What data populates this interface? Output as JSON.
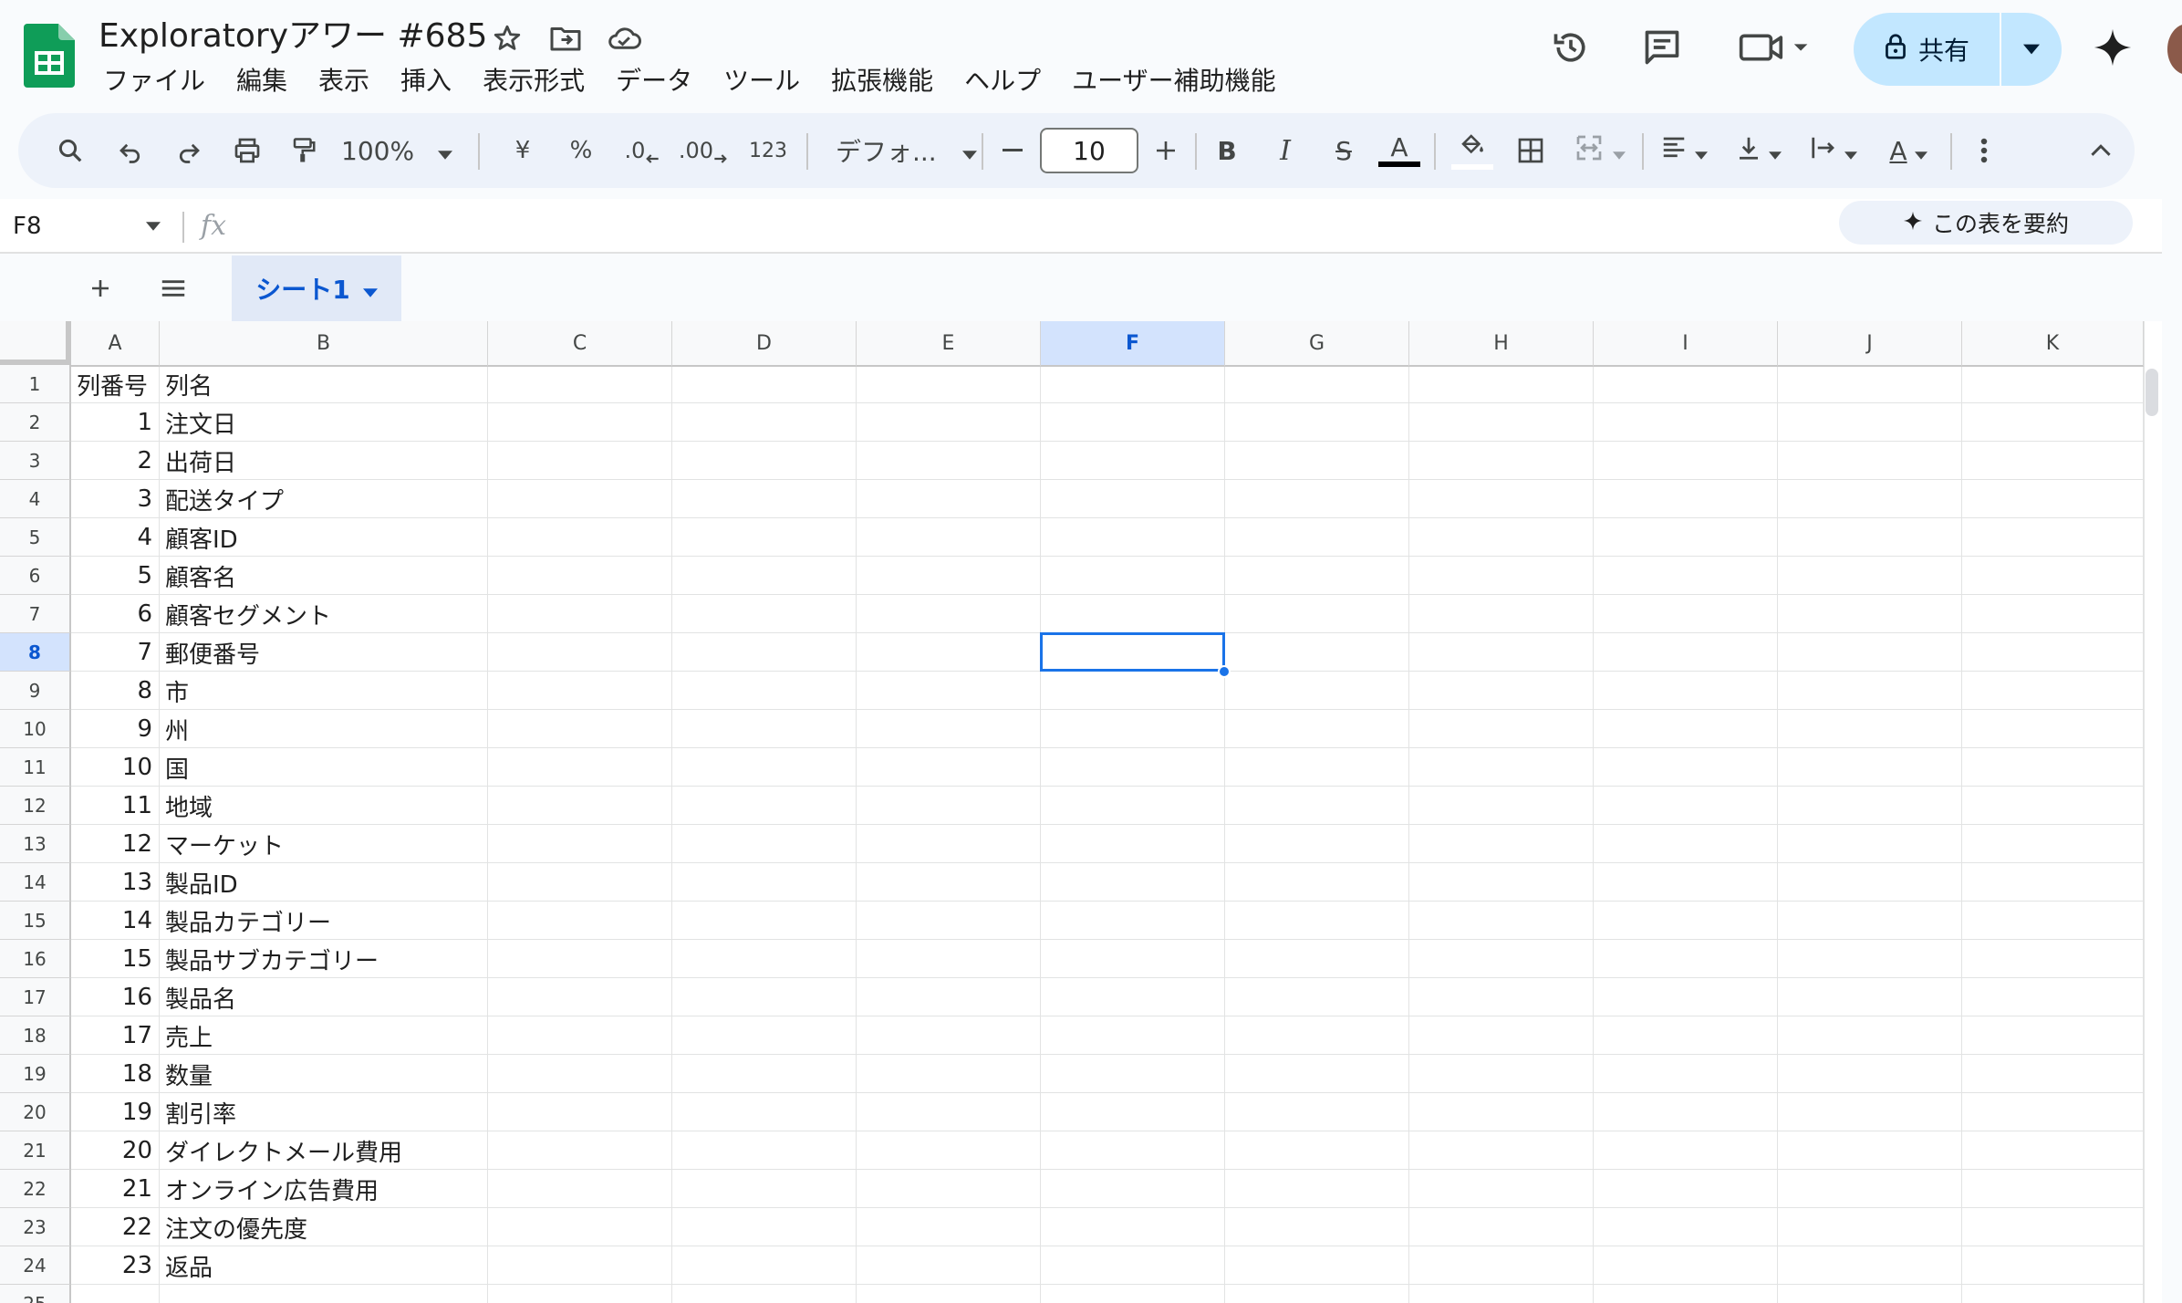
{
  "app": {
    "title": "Exploratoryアワー #685",
    "share_label": "共有"
  },
  "menu": [
    "ファイル",
    "編集",
    "表示",
    "挿入",
    "表示形式",
    "データ",
    "ツール",
    "拡張機能",
    "ヘルプ",
    "ユーザー補助機能"
  ],
  "toolbar": {
    "zoom": "100%",
    "currency": "¥",
    "percent": "%",
    "dec_decrease": ".0",
    "dec_increase": ".00",
    "number_format": "123",
    "font": "デフォ...",
    "font_size": "10",
    "bold": "B",
    "italic": "I",
    "strike": "S",
    "text_color": "A",
    "text_rotate": "A"
  },
  "formula": {
    "name_box": "F8",
    "fx": "fx",
    "summarize_label": "この表を要約"
  },
  "sheet": {
    "tab_label": "シート1"
  },
  "grid": {
    "columns": [
      "A",
      "B",
      "C",
      "D",
      "E",
      "F",
      "G",
      "H",
      "I",
      "J",
      "K"
    ],
    "selected_column": "F",
    "selected_row": "8",
    "row_numbers": [
      "1",
      "2",
      "3",
      "4",
      "5",
      "6",
      "7",
      "8",
      "9",
      "10",
      "11",
      "12",
      "13",
      "14",
      "15",
      "16",
      "17",
      "18",
      "19",
      "20",
      "21",
      "22",
      "23",
      "24",
      "25"
    ],
    "rows": [
      [
        "列番号",
        "列名"
      ],
      [
        "1",
        "注文日"
      ],
      [
        "2",
        "出荷日"
      ],
      [
        "3",
        "配送タイプ"
      ],
      [
        "4",
        "顧客ID"
      ],
      [
        "5",
        "顧客名"
      ],
      [
        "6",
        "顧客セグメント"
      ],
      [
        "7",
        "郵便番号"
      ],
      [
        "8",
        "市"
      ],
      [
        "9",
        "州"
      ],
      [
        "10",
        "国"
      ],
      [
        "11",
        "地域"
      ],
      [
        "12",
        "マーケット"
      ],
      [
        "13",
        "製品ID"
      ],
      [
        "14",
        "製品カテゴリー"
      ],
      [
        "15",
        "製品サブカテゴリー"
      ],
      [
        "16",
        "製品名"
      ],
      [
        "17",
        "売上"
      ],
      [
        "18",
        "数量"
      ],
      [
        "19",
        "割引率"
      ],
      [
        "20",
        "ダイレクトメール費用"
      ],
      [
        "21",
        "オンライン広告費用"
      ],
      [
        "22",
        "注文の優先度"
      ],
      [
        "23",
        "返品"
      ]
    ]
  },
  "colors": {
    "accent": "#0b57d0",
    "share_bg": "#c2e7ff",
    "selection": "#1a73e8",
    "header_selected": "#d3e3fd",
    "logo_green": "#0f9d58"
  }
}
